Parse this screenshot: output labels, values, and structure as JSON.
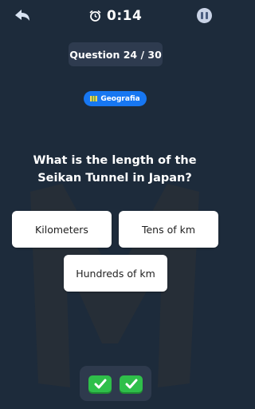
{
  "timer": {
    "value": "0:14"
  },
  "quiz": {
    "counter": "Question 24 / 30",
    "category": "Geografia",
    "question": "What is the length of the Seikan Tunnel in Japan?"
  },
  "answers": [
    "Kilometers",
    "Tens of km",
    "Hundreds of km"
  ],
  "icons": {
    "back": "back-arrow-icon",
    "timer": "alarm-clock-icon",
    "pause": "pause-icon",
    "category": "map-icon",
    "hint": "checkmark-icon"
  },
  "colors": {
    "background": "#1d2b3b",
    "badge": "#1777f2",
    "check": "#2fbf4a",
    "panel": "#2e3b4f"
  }
}
